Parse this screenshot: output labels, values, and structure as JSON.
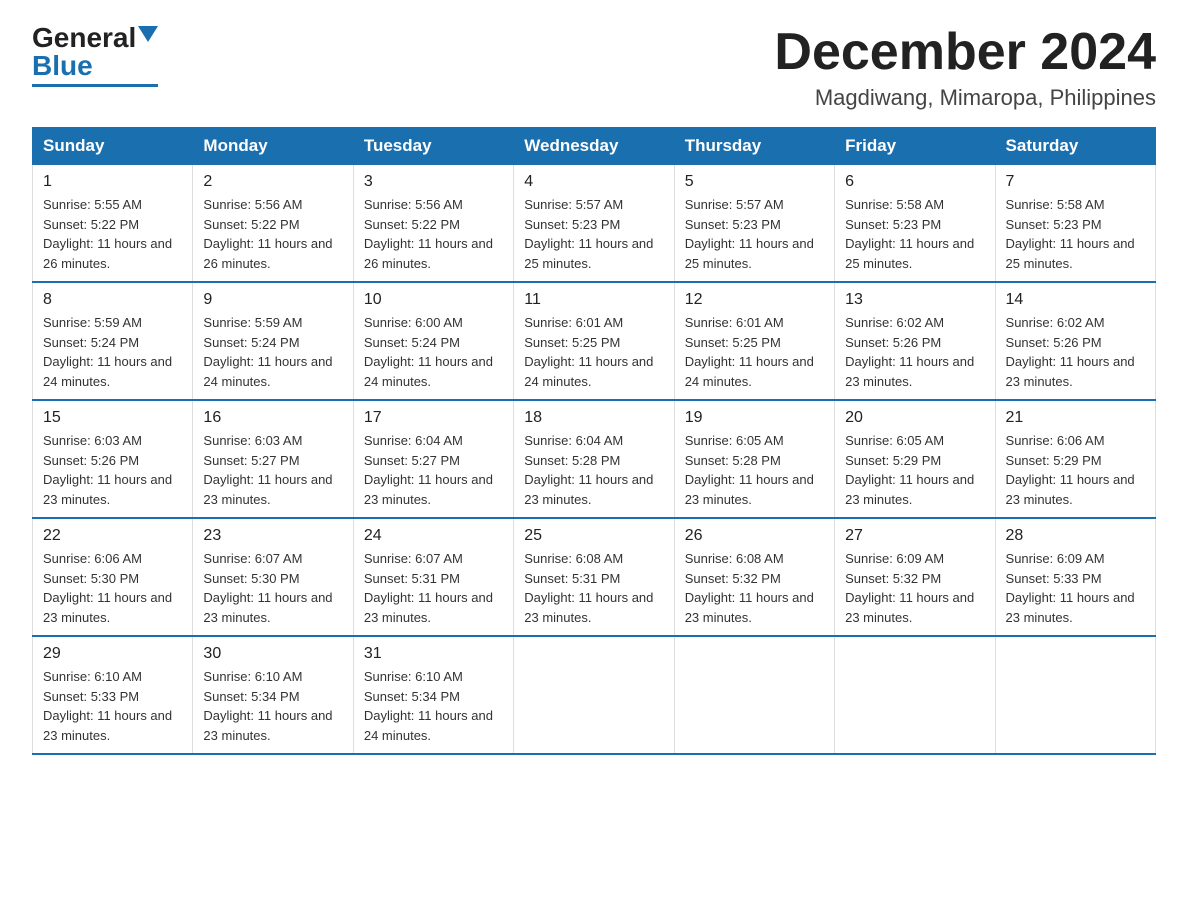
{
  "header": {
    "logo_general": "General",
    "logo_blue": "Blue",
    "month_title": "December 2024",
    "location": "Magdiwang, Mimaropa, Philippines"
  },
  "days_of_week": [
    "Sunday",
    "Monday",
    "Tuesday",
    "Wednesday",
    "Thursday",
    "Friday",
    "Saturday"
  ],
  "weeks": [
    [
      {
        "day": "1",
        "sunrise": "5:55 AM",
        "sunset": "5:22 PM",
        "daylight": "11 hours and 26 minutes."
      },
      {
        "day": "2",
        "sunrise": "5:56 AM",
        "sunset": "5:22 PM",
        "daylight": "11 hours and 26 minutes."
      },
      {
        "day": "3",
        "sunrise": "5:56 AM",
        "sunset": "5:22 PM",
        "daylight": "11 hours and 26 minutes."
      },
      {
        "day": "4",
        "sunrise": "5:57 AM",
        "sunset": "5:23 PM",
        "daylight": "11 hours and 25 minutes."
      },
      {
        "day": "5",
        "sunrise": "5:57 AM",
        "sunset": "5:23 PM",
        "daylight": "11 hours and 25 minutes."
      },
      {
        "day": "6",
        "sunrise": "5:58 AM",
        "sunset": "5:23 PM",
        "daylight": "11 hours and 25 minutes."
      },
      {
        "day": "7",
        "sunrise": "5:58 AM",
        "sunset": "5:23 PM",
        "daylight": "11 hours and 25 minutes."
      }
    ],
    [
      {
        "day": "8",
        "sunrise": "5:59 AM",
        "sunset": "5:24 PM",
        "daylight": "11 hours and 24 minutes."
      },
      {
        "day": "9",
        "sunrise": "5:59 AM",
        "sunset": "5:24 PM",
        "daylight": "11 hours and 24 minutes."
      },
      {
        "day": "10",
        "sunrise": "6:00 AM",
        "sunset": "5:24 PM",
        "daylight": "11 hours and 24 minutes."
      },
      {
        "day": "11",
        "sunrise": "6:01 AM",
        "sunset": "5:25 PM",
        "daylight": "11 hours and 24 minutes."
      },
      {
        "day": "12",
        "sunrise": "6:01 AM",
        "sunset": "5:25 PM",
        "daylight": "11 hours and 24 minutes."
      },
      {
        "day": "13",
        "sunrise": "6:02 AM",
        "sunset": "5:26 PM",
        "daylight": "11 hours and 23 minutes."
      },
      {
        "day": "14",
        "sunrise": "6:02 AM",
        "sunset": "5:26 PM",
        "daylight": "11 hours and 23 minutes."
      }
    ],
    [
      {
        "day": "15",
        "sunrise": "6:03 AM",
        "sunset": "5:26 PM",
        "daylight": "11 hours and 23 minutes."
      },
      {
        "day": "16",
        "sunrise": "6:03 AM",
        "sunset": "5:27 PM",
        "daylight": "11 hours and 23 minutes."
      },
      {
        "day": "17",
        "sunrise": "6:04 AM",
        "sunset": "5:27 PM",
        "daylight": "11 hours and 23 minutes."
      },
      {
        "day": "18",
        "sunrise": "6:04 AM",
        "sunset": "5:28 PM",
        "daylight": "11 hours and 23 minutes."
      },
      {
        "day": "19",
        "sunrise": "6:05 AM",
        "sunset": "5:28 PM",
        "daylight": "11 hours and 23 minutes."
      },
      {
        "day": "20",
        "sunrise": "6:05 AM",
        "sunset": "5:29 PM",
        "daylight": "11 hours and 23 minutes."
      },
      {
        "day": "21",
        "sunrise": "6:06 AM",
        "sunset": "5:29 PM",
        "daylight": "11 hours and 23 minutes."
      }
    ],
    [
      {
        "day": "22",
        "sunrise": "6:06 AM",
        "sunset": "5:30 PM",
        "daylight": "11 hours and 23 minutes."
      },
      {
        "day": "23",
        "sunrise": "6:07 AM",
        "sunset": "5:30 PM",
        "daylight": "11 hours and 23 minutes."
      },
      {
        "day": "24",
        "sunrise": "6:07 AM",
        "sunset": "5:31 PM",
        "daylight": "11 hours and 23 minutes."
      },
      {
        "day": "25",
        "sunrise": "6:08 AM",
        "sunset": "5:31 PM",
        "daylight": "11 hours and 23 minutes."
      },
      {
        "day": "26",
        "sunrise": "6:08 AM",
        "sunset": "5:32 PM",
        "daylight": "11 hours and 23 minutes."
      },
      {
        "day": "27",
        "sunrise": "6:09 AM",
        "sunset": "5:32 PM",
        "daylight": "11 hours and 23 minutes."
      },
      {
        "day": "28",
        "sunrise": "6:09 AM",
        "sunset": "5:33 PM",
        "daylight": "11 hours and 23 minutes."
      }
    ],
    [
      {
        "day": "29",
        "sunrise": "6:10 AM",
        "sunset": "5:33 PM",
        "daylight": "11 hours and 23 minutes."
      },
      {
        "day": "30",
        "sunrise": "6:10 AM",
        "sunset": "5:34 PM",
        "daylight": "11 hours and 23 minutes."
      },
      {
        "day": "31",
        "sunrise": "6:10 AM",
        "sunset": "5:34 PM",
        "daylight": "11 hours and 24 minutes."
      },
      null,
      null,
      null,
      null
    ]
  ]
}
